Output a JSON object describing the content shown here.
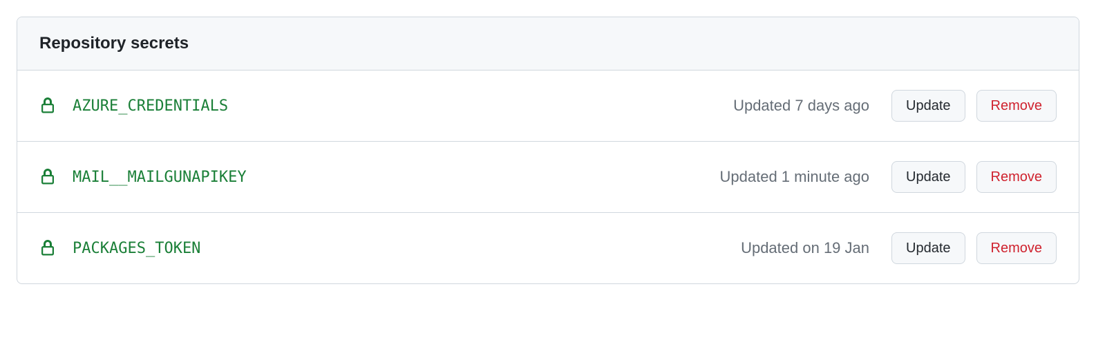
{
  "panel": {
    "title": "Repository secrets"
  },
  "secrets": [
    {
      "name": "AZURE_CREDENTIALS",
      "updated": "Updated 7 days ago",
      "update_label": "Update",
      "remove_label": "Remove"
    },
    {
      "name": "MAIL__MAILGUNAPIKEY",
      "updated": "Updated 1 minute ago",
      "update_label": "Update",
      "remove_label": "Remove"
    },
    {
      "name": "PACKAGES_TOKEN",
      "updated": "Updated on 19 Jan",
      "update_label": "Update",
      "remove_label": "Remove"
    }
  ]
}
